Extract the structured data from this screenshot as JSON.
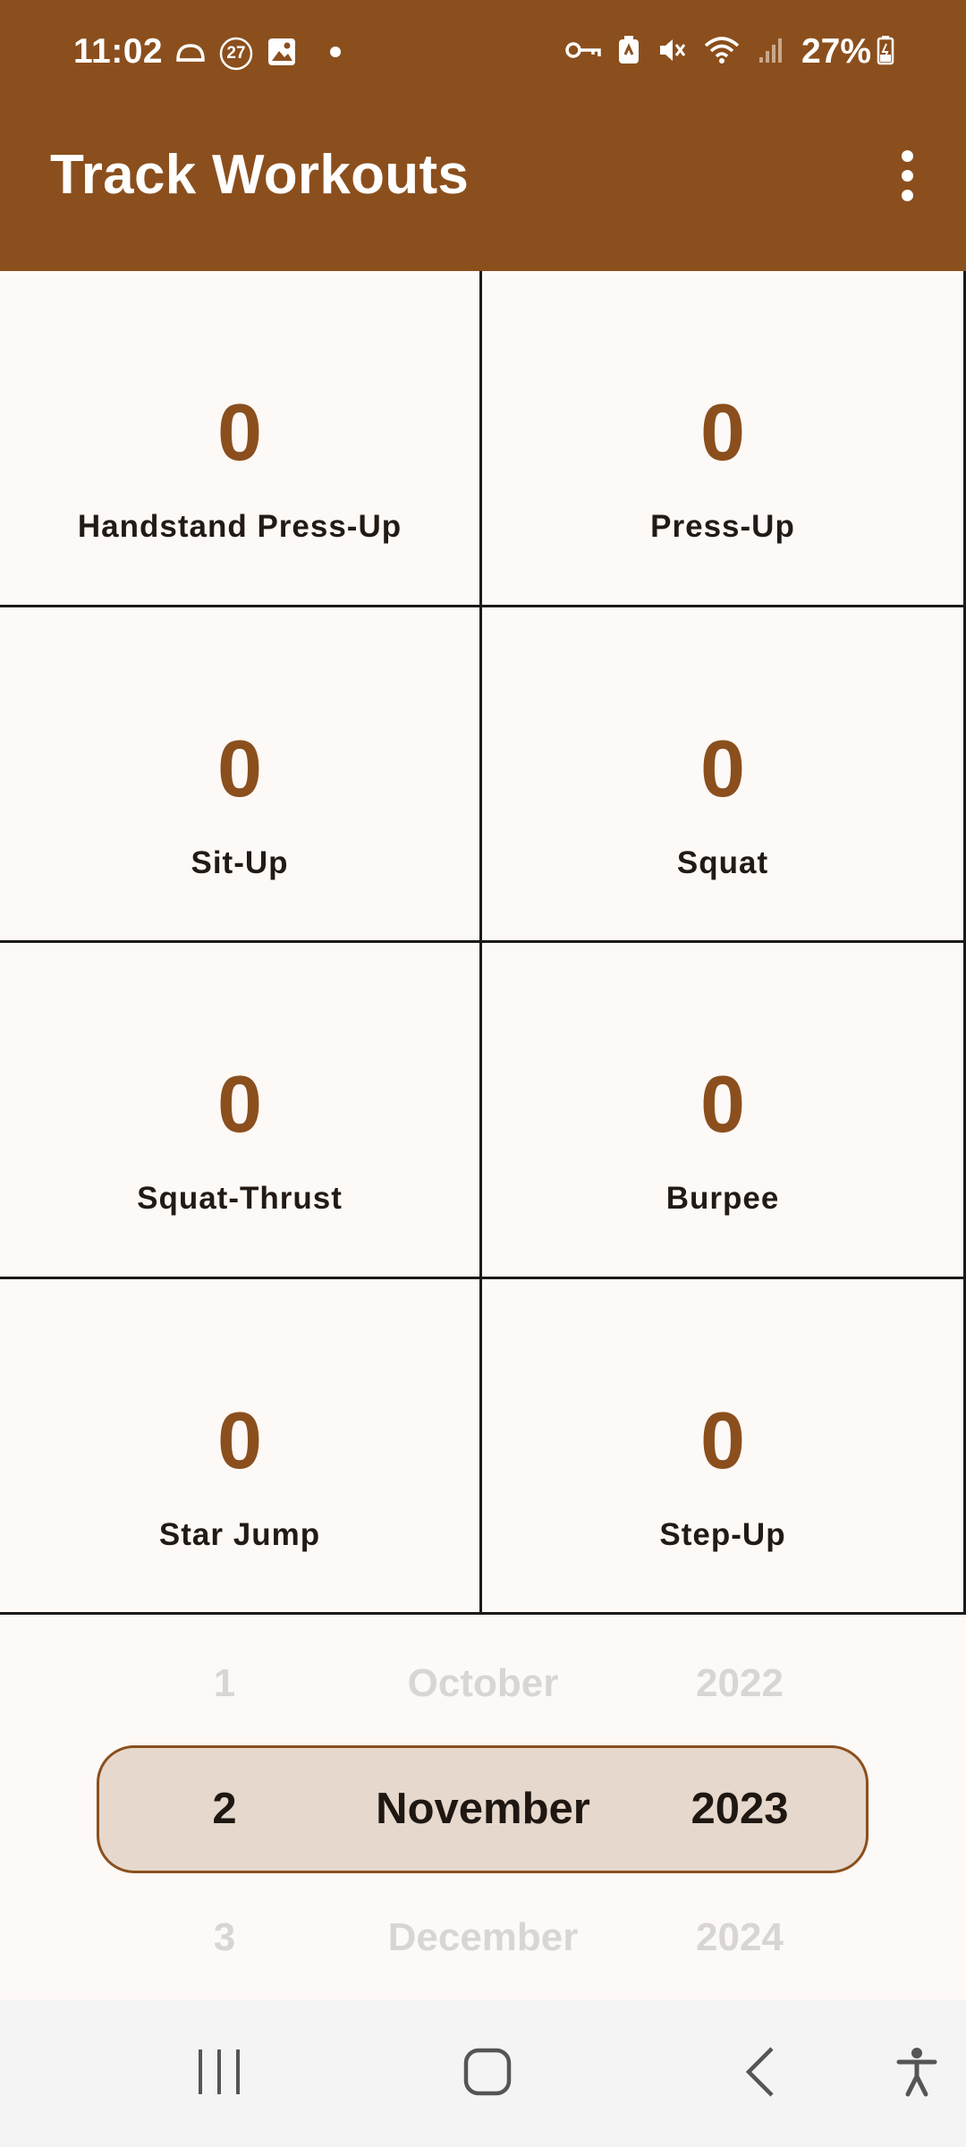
{
  "status_bar": {
    "time": "11:02",
    "notification_badge": "27",
    "battery_percent": "27%",
    "icons_left": [
      "cloud-icon",
      "notification-count-icon",
      "gallery-icon",
      "dot-icon"
    ],
    "icons_right": [
      "vpn-key-icon",
      "battery-saver-icon",
      "mute-icon",
      "wifi-icon",
      "signal-icon",
      "battery-icon"
    ]
  },
  "app_bar": {
    "title": "Track Workouts",
    "overflow_icon": "more-vert-icon"
  },
  "workouts": [
    {
      "count": "0",
      "name": "Handstand Press-Up"
    },
    {
      "count": "0",
      "name": "Press-Up"
    },
    {
      "count": "0",
      "name": "Sit-Up"
    },
    {
      "count": "0",
      "name": "Squat"
    },
    {
      "count": "0",
      "name": "Squat-Thrust"
    },
    {
      "count": "0",
      "name": "Burpee"
    },
    {
      "count": "0",
      "name": "Star Jump"
    },
    {
      "count": "0",
      "name": "Step-Up"
    }
  ],
  "date_picker": {
    "previous": {
      "day": "1",
      "month": "October",
      "year": "2022"
    },
    "selected": {
      "day": "2",
      "month": "November",
      "year": "2023"
    },
    "next": {
      "day": "3",
      "month": "December",
      "year": "2024"
    }
  },
  "nav_bar": {
    "buttons": [
      "recent-apps-icon",
      "home-icon",
      "back-icon",
      "accessibility-icon"
    ]
  },
  "colors": {
    "brand": "#8b4f1d",
    "background": "#fdf9f7",
    "selected_fill": "#e6d8cc",
    "dim_text": "#d9d5d3"
  }
}
